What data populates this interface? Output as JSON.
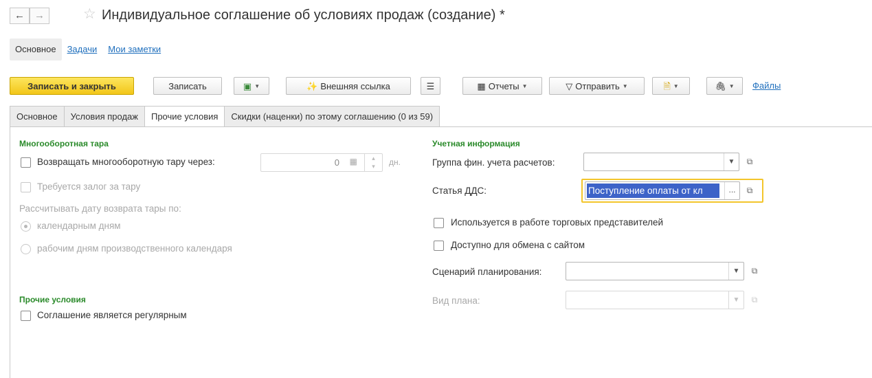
{
  "window": {
    "back_icon": "arrow-left-icon",
    "forward_icon": "arrow-right-icon",
    "favorite_icon": "star-icon",
    "title": "Индивидуальное соглашение об условиях продаж (создание) *"
  },
  "nav_panel": {
    "items": [
      {
        "label": "Основное",
        "active": true
      },
      {
        "label": "Задачи",
        "active": false
      },
      {
        "label": "Мои заметки",
        "active": false
      }
    ]
  },
  "toolbar": {
    "save_close_label": "Записать и закрыть",
    "save_label": "Записать",
    "external_link_label": "Внешняя ссылка",
    "reports_label": "Отчеты",
    "send_label": "Отправить",
    "files_label": "Файлы",
    "colors": {
      "primary": "#f2c619",
      "link": "#1f6fbd"
    }
  },
  "tabs": [
    {
      "label": "Основное",
      "active": false
    },
    {
      "label": "Условия продаж",
      "active": false
    },
    {
      "label": "Прочие условия",
      "active": true
    },
    {
      "label": "Скидки (наценки) по этому соглашению (0 из 59)",
      "active": false
    }
  ],
  "returnable_packaging": {
    "group_title": "Многооборотная тара",
    "return_label": "Возвращать многооборотную тару через:",
    "return_checked": false,
    "days_value": "0",
    "days_unit": "дн.",
    "deposit_label": "Требуется залог за тару",
    "deposit_checked": false,
    "calc_label": "Рассчитывать дату возврата тары по:",
    "option_calendar": "календарным дням",
    "option_work": "рабочим дням производственного календаря",
    "selected_option": "календарным дням"
  },
  "other_conditions": {
    "group_title": "Прочие условия",
    "regular_label": "Соглашение является регулярным",
    "regular_checked": false
  },
  "accounting": {
    "group_title": "Учетная информация",
    "fin_group_label": "Группа фин. учета расчетов:",
    "fin_group_value": "",
    "dds_label": "Статья ДДС:",
    "dds_value": "Поступление оплаты от кл",
    "dds_more": "...",
    "sales_reps_label": "Используется в работе торговых представителей",
    "sales_reps_checked": false,
    "site_exchange_label": "Доступно для обмена с сайтом",
    "site_exchange_checked": false,
    "planning_label": "Сценарий планирования:",
    "planning_value": "",
    "plan_type_label": "Вид плана:",
    "plan_type_value": "",
    "highlight_color": "#f3c52b",
    "selection_color": "#3d63c8"
  },
  "icons": {
    "dropdown": "dropdown-arrow-icon",
    "open": "open-icon",
    "calendar": "calendar-icon",
    "spinner": "spinner-icon"
  }
}
